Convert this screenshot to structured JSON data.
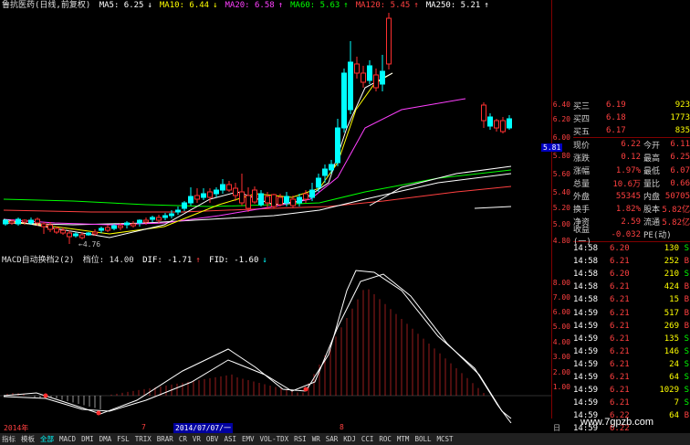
{
  "legend": {
    "title": "鲁抗医药(日线,前复权)",
    "ma": [
      {
        "label": "MA5: 6.25",
        "color": "#ffffff",
        "arrow": "↓"
      },
      {
        "label": "MA10: 6.44",
        "color": "#ffff00",
        "arrow": "↓"
      },
      {
        "label": "MA20: 6.58",
        "color": "#ff40ff",
        "arrow": "↑"
      },
      {
        "label": "MA60: 5.63",
        "color": "#00ff00",
        "arrow": "↑"
      },
      {
        "label": "MA120: 5.45",
        "color": "#ff4040",
        "arrow": "↑"
      },
      {
        "label": "MA250: 5.21",
        "color": "#ffffff",
        "arrow": "↑"
      }
    ]
  },
  "price_axis": {
    "ticks": [
      "6.40",
      "6.20",
      "6.00",
      "5.80",
      "5.60",
      "5.40",
      "5.20",
      "5.00",
      "4.80"
    ],
    "current_label": "5.81",
    "low_label": "4.76"
  },
  "macd_legend": {
    "name": "MACD自动换档2(2)",
    "gear": "档位: 14.00",
    "dif": "DIF: -1.71",
    "dif_arrow": "↑",
    "fid": "FID: -1.60",
    "fid_arrow": "↓"
  },
  "macd_axis": {
    "ticks": [
      "8.00",
      "7.00",
      "6.00",
      "5.00",
      "4.00",
      "3.00",
      "2.00",
      "1.00"
    ]
  },
  "time_axis": {
    "labels": [
      "2014年",
      "7",
      "2014/07/07/一",
      "8"
    ],
    "end_label": "日"
  },
  "bottom_tabs": [
    "指标",
    "模板",
    "全部",
    "MACD",
    "DMI",
    "DMA",
    "FSL",
    "TRIX",
    "BRAR",
    "CR",
    "VR",
    "OBV",
    "ASI",
    "EMV",
    "VOL-TDX",
    "RSI",
    "WR",
    "SAR",
    "KDJ",
    "CCI",
    "ROC",
    "MTM",
    "BOLL",
    "MCST"
  ],
  "quote": {
    "orders": [
      {
        "label": "买三",
        "price": "6.19",
        "vol": "923"
      },
      {
        "label": "买四",
        "price": "6.18",
        "vol": "1773"
      },
      {
        "label": "买五",
        "price": "6.17",
        "vol": "835"
      }
    ],
    "stats": [
      {
        "l1": "现价",
        "v1": "6.22",
        "l2": "今开",
        "v2": "6.11"
      },
      {
        "l1": "涨跌",
        "v1": "0.12",
        "l2": "最高",
        "v2": "6.25"
      },
      {
        "l1": "涨幅",
        "v1": "1.97%",
        "l2": "最低",
        "v2": "6.07"
      },
      {
        "l1": "总量",
        "v1": "10.6万",
        "l2": "量比",
        "v2": "0.66"
      },
      {
        "l1": "外盘",
        "v1": "55345",
        "l2": "内盘",
        "v2": "50705"
      },
      {
        "l1": "换手",
        "v1": "1.82%",
        "l2": "股本",
        "v2": "5.82亿"
      },
      {
        "l1": "净资",
        "v1": "2.59",
        "l2": "流通",
        "v2": "5.82亿"
      },
      {
        "l1": "收益(一)",
        "v1": "-0.032",
        "l2": "PE(动)",
        "v2": ""
      }
    ],
    "ticks": [
      {
        "t": "14:58",
        "p": "6.20",
        "v": "130",
        "s": "S"
      },
      {
        "t": "14:58",
        "p": "6.21",
        "v": "252",
        "s": "B"
      },
      {
        "t": "14:58",
        "p": "6.20",
        "v": "210",
        "s": "S"
      },
      {
        "t": "14:58",
        "p": "6.21",
        "v": "424",
        "s": "B"
      },
      {
        "t": "14:58",
        "p": "6.21",
        "v": "15",
        "s": "B"
      },
      {
        "t": "14:59",
        "p": "6.21",
        "v": "517",
        "s": "B"
      },
      {
        "t": "14:59",
        "p": "6.21",
        "v": "269",
        "s": "B"
      },
      {
        "t": "14:59",
        "p": "6.21",
        "v": "135",
        "s": "S"
      },
      {
        "t": "14:59",
        "p": "6.21",
        "v": "146",
        "s": "S"
      },
      {
        "t": "14:59",
        "p": "6.21",
        "v": "24",
        "s": "S"
      },
      {
        "t": "14:59",
        "p": "6.21",
        "v": "64",
        "s": "S"
      },
      {
        "t": "14:59",
        "p": "6.21",
        "v": "1029",
        "s": "S"
      },
      {
        "t": "14:59",
        "p": "6.21",
        "v": "7",
        "s": "S"
      },
      {
        "t": "14:59",
        "p": "6.22",
        "v": "64",
        "s": "B"
      },
      {
        "t": "14:59",
        "p": "6.22",
        "v": "",
        "s": ""
      }
    ]
  },
  "watermark": "www.7gpzb.com",
  "colors": {
    "up": "#ff3030",
    "down": "#00ffff",
    "axis": "#ff4040",
    "ma5": "#ffffff",
    "ma10": "#ffff00",
    "ma20": "#ff40ff",
    "ma60": "#00ff00",
    "ma120": "#ff4040",
    "ma250": "#ffffff"
  }
}
